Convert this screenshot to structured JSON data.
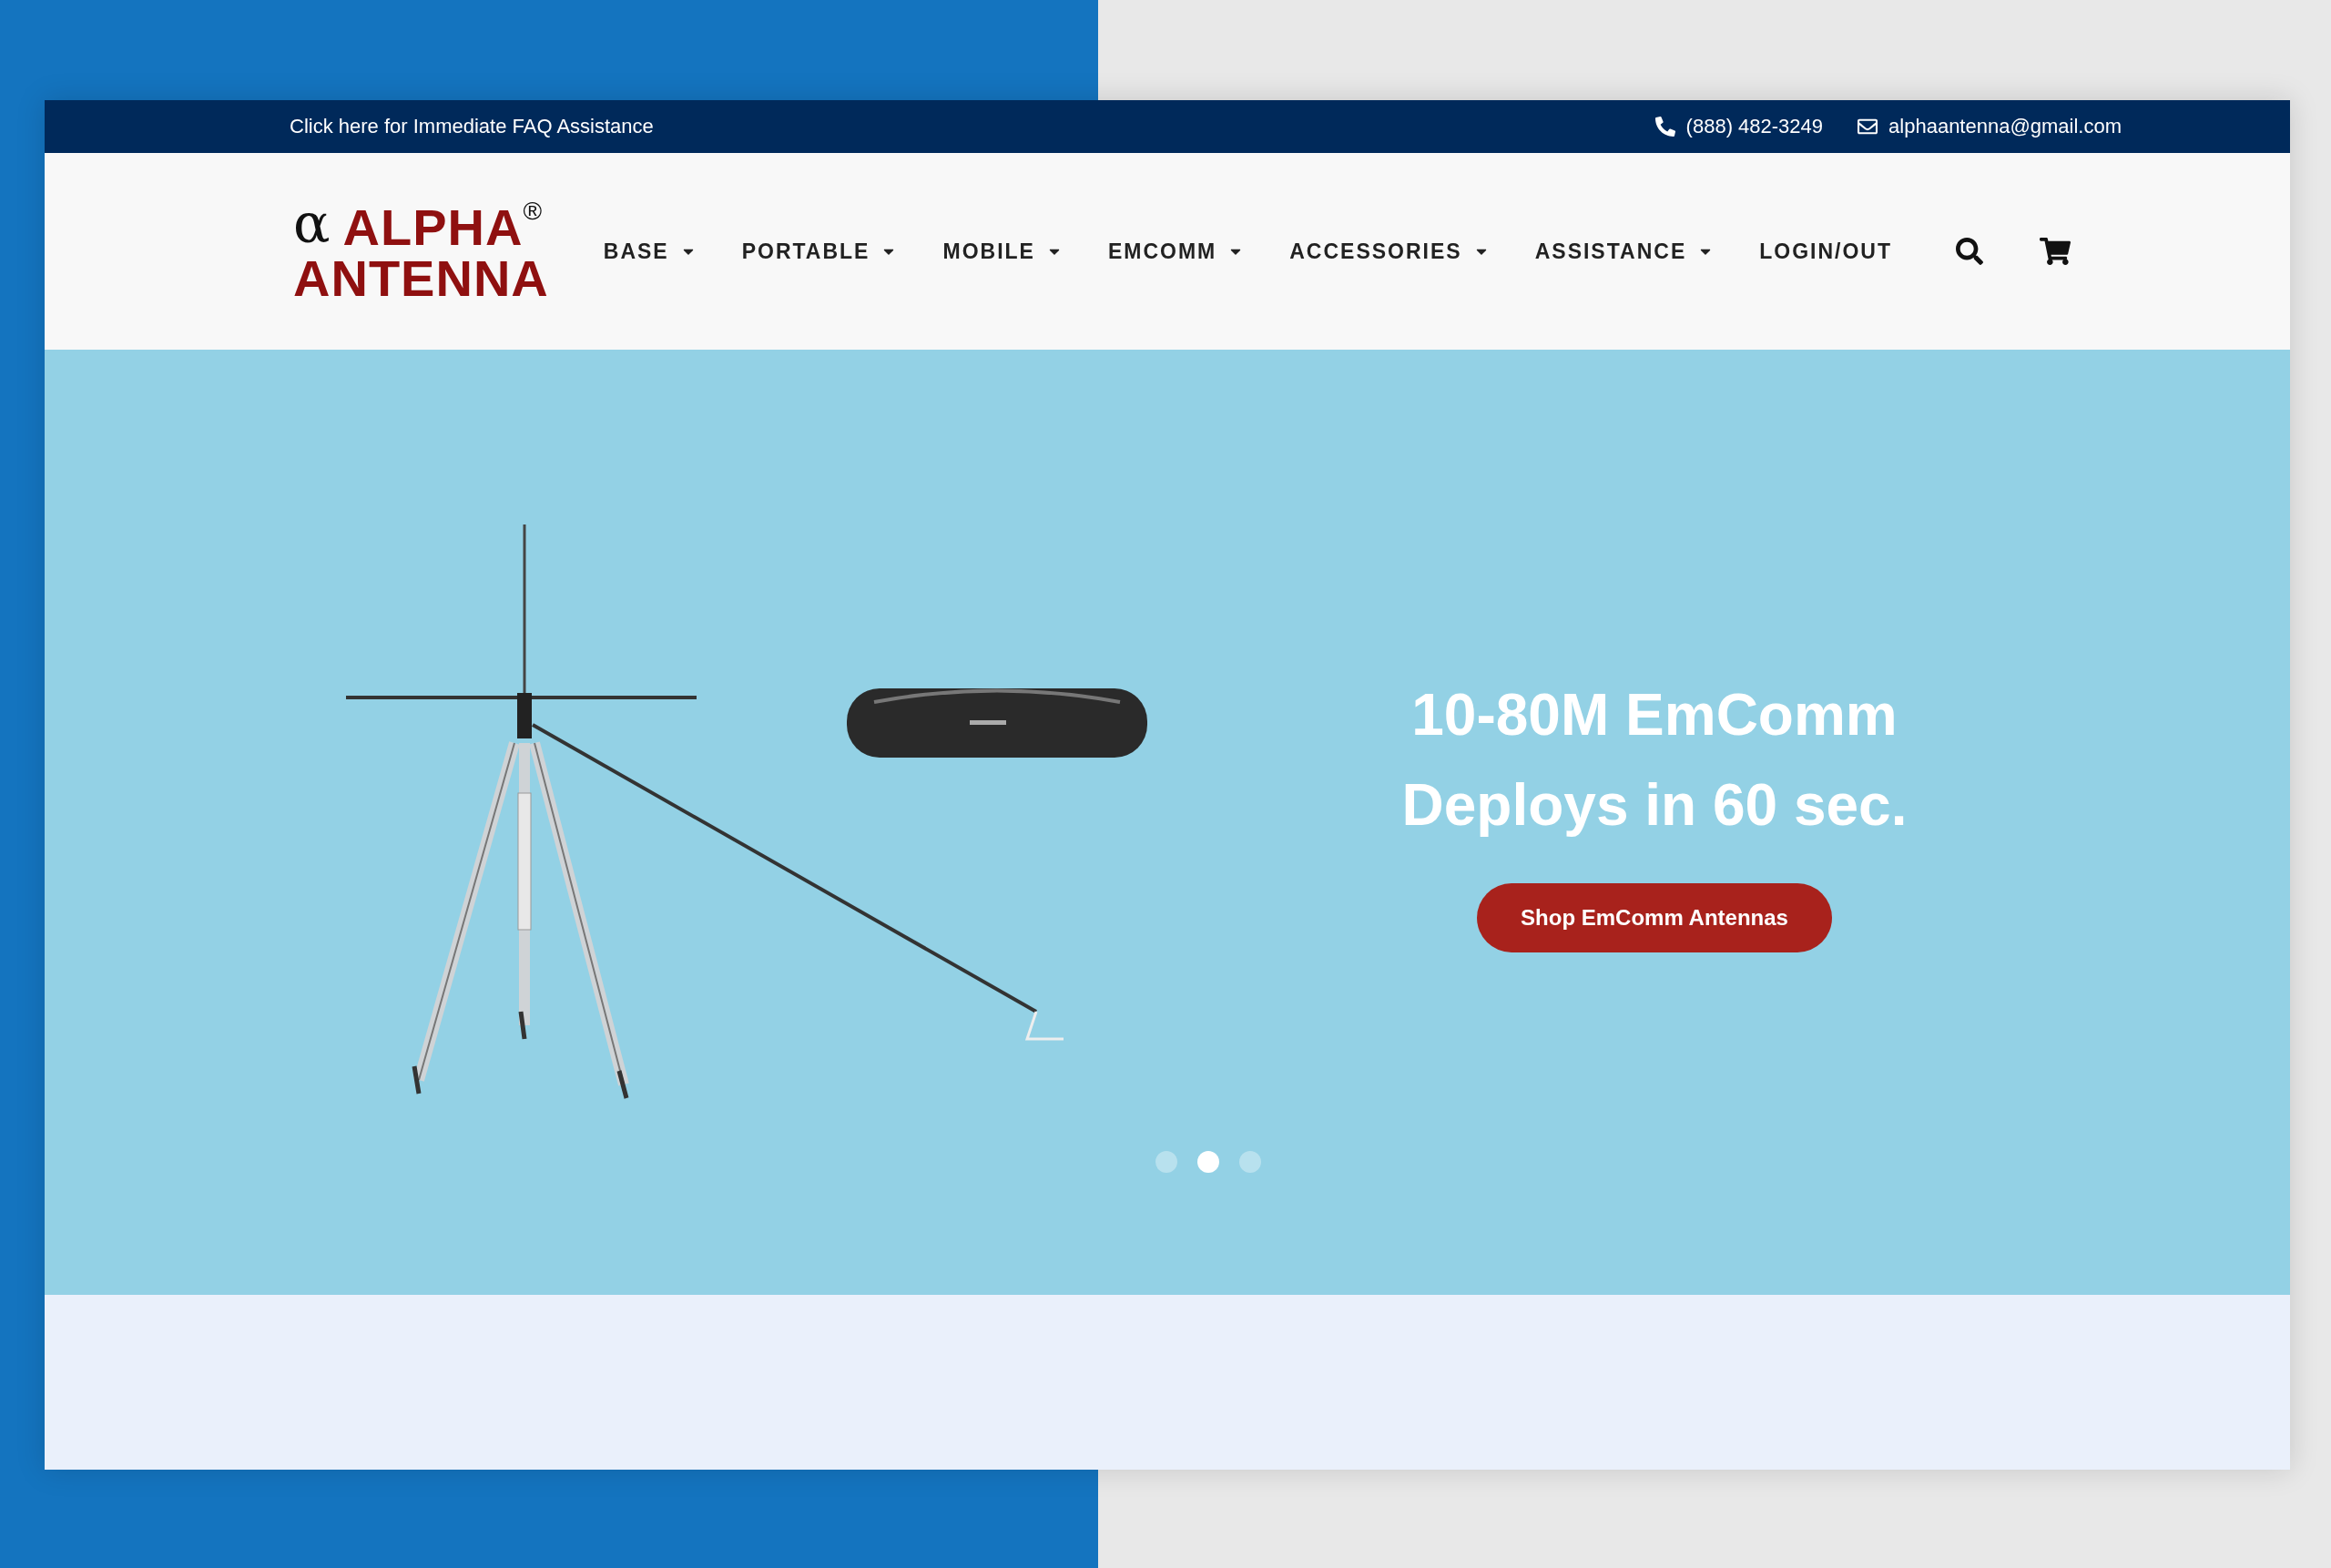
{
  "top_bar": {
    "faq_link": "Click here for Immediate FAQ Assistance",
    "phone": "(888) 482-3249",
    "email": "alphaantenna@gmail.com"
  },
  "header": {
    "logo": {
      "symbol": "α",
      "name": "ALPHA",
      "mark": "®",
      "line2": "ANTENNA"
    },
    "nav": [
      {
        "label": "BASE",
        "dropdown": true
      },
      {
        "label": "PORTABLE",
        "dropdown": true
      },
      {
        "label": "MOBILE",
        "dropdown": true
      },
      {
        "label": "EMCOMM",
        "dropdown": true
      },
      {
        "label": "ACCESSORIES",
        "dropdown": true
      },
      {
        "label": "ASSISTANCE",
        "dropdown": true
      },
      {
        "label": "LOGIN/OUT",
        "dropdown": false
      }
    ]
  },
  "hero": {
    "heading": [
      "10-80M EmComm",
      "Deploys in 60 sec."
    ],
    "button": "Shop EmComm Antennas",
    "dots": [
      {
        "selected": false
      },
      {
        "selected": true
      },
      {
        "selected": false
      }
    ]
  }
}
